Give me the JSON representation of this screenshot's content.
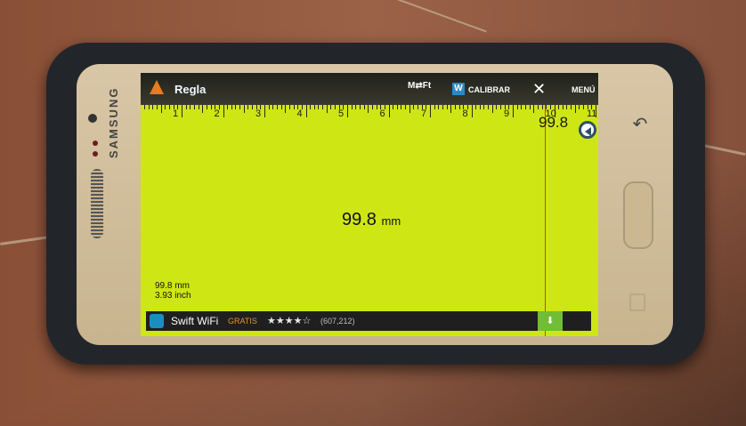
{
  "app": {
    "title": "Regla",
    "toolbar": {
      "units_toggle": "M⇄Ft",
      "calibrate_icon_label": "W",
      "calibrate_label": "CALIBRAR",
      "close_symbol": "✕",
      "menu_label": "MENÚ"
    },
    "ruler": {
      "numbers": [
        "1",
        "2",
        "3",
        "4",
        "5",
        "6",
        "7",
        "8",
        "9",
        "10",
        "11"
      ],
      "current_reading_top": "99.8"
    },
    "measurement": {
      "value": "99.8",
      "unit": "mm",
      "summary_mm": "99.8 mm",
      "summary_inch": "3.93 inch"
    },
    "ad": {
      "name": "Swift WiFi",
      "price": "GRATIS",
      "stars": "★★★★☆",
      "reviews": "(607,212)",
      "download_symbol": "⬇"
    }
  },
  "device": {
    "brand": "SAMSUNG",
    "back_symbol": "↶"
  },
  "colors": {
    "screen_bg": "#cfe615",
    "accent_red": "#d43b2a",
    "toolbar_bg": "#20211a"
  }
}
